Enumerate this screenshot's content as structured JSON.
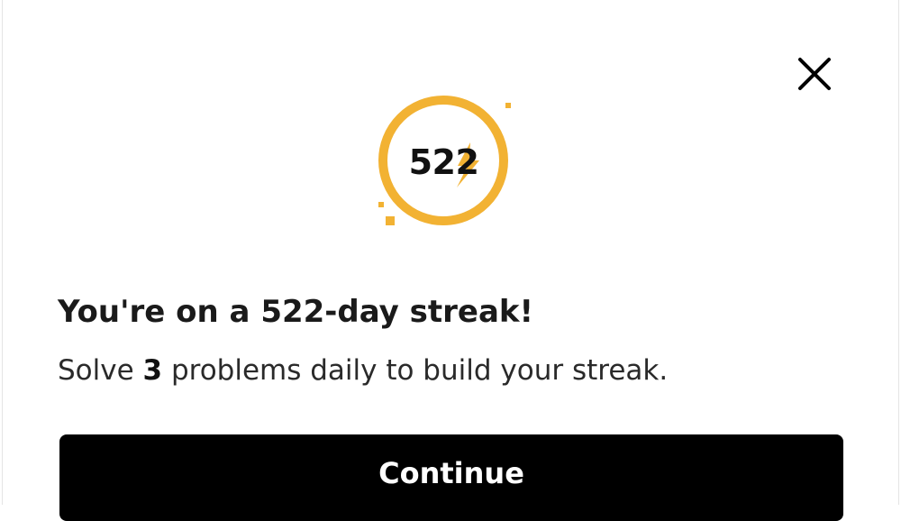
{
  "icons": {
    "close": "close-icon",
    "streak": "lightning-bolt-icon"
  },
  "colors": {
    "accent": "#F2B233",
    "text": "#1A1A1A",
    "button_background": "#000000",
    "button_text": "#FFFFFF"
  },
  "badge": {
    "count": "522"
  },
  "headline": "You're on a 522-day streak!",
  "subtext": {
    "before": "Solve ",
    "count": "3",
    "after": " problems daily to build your streak."
  },
  "continue_button": {
    "label": "Continue"
  }
}
